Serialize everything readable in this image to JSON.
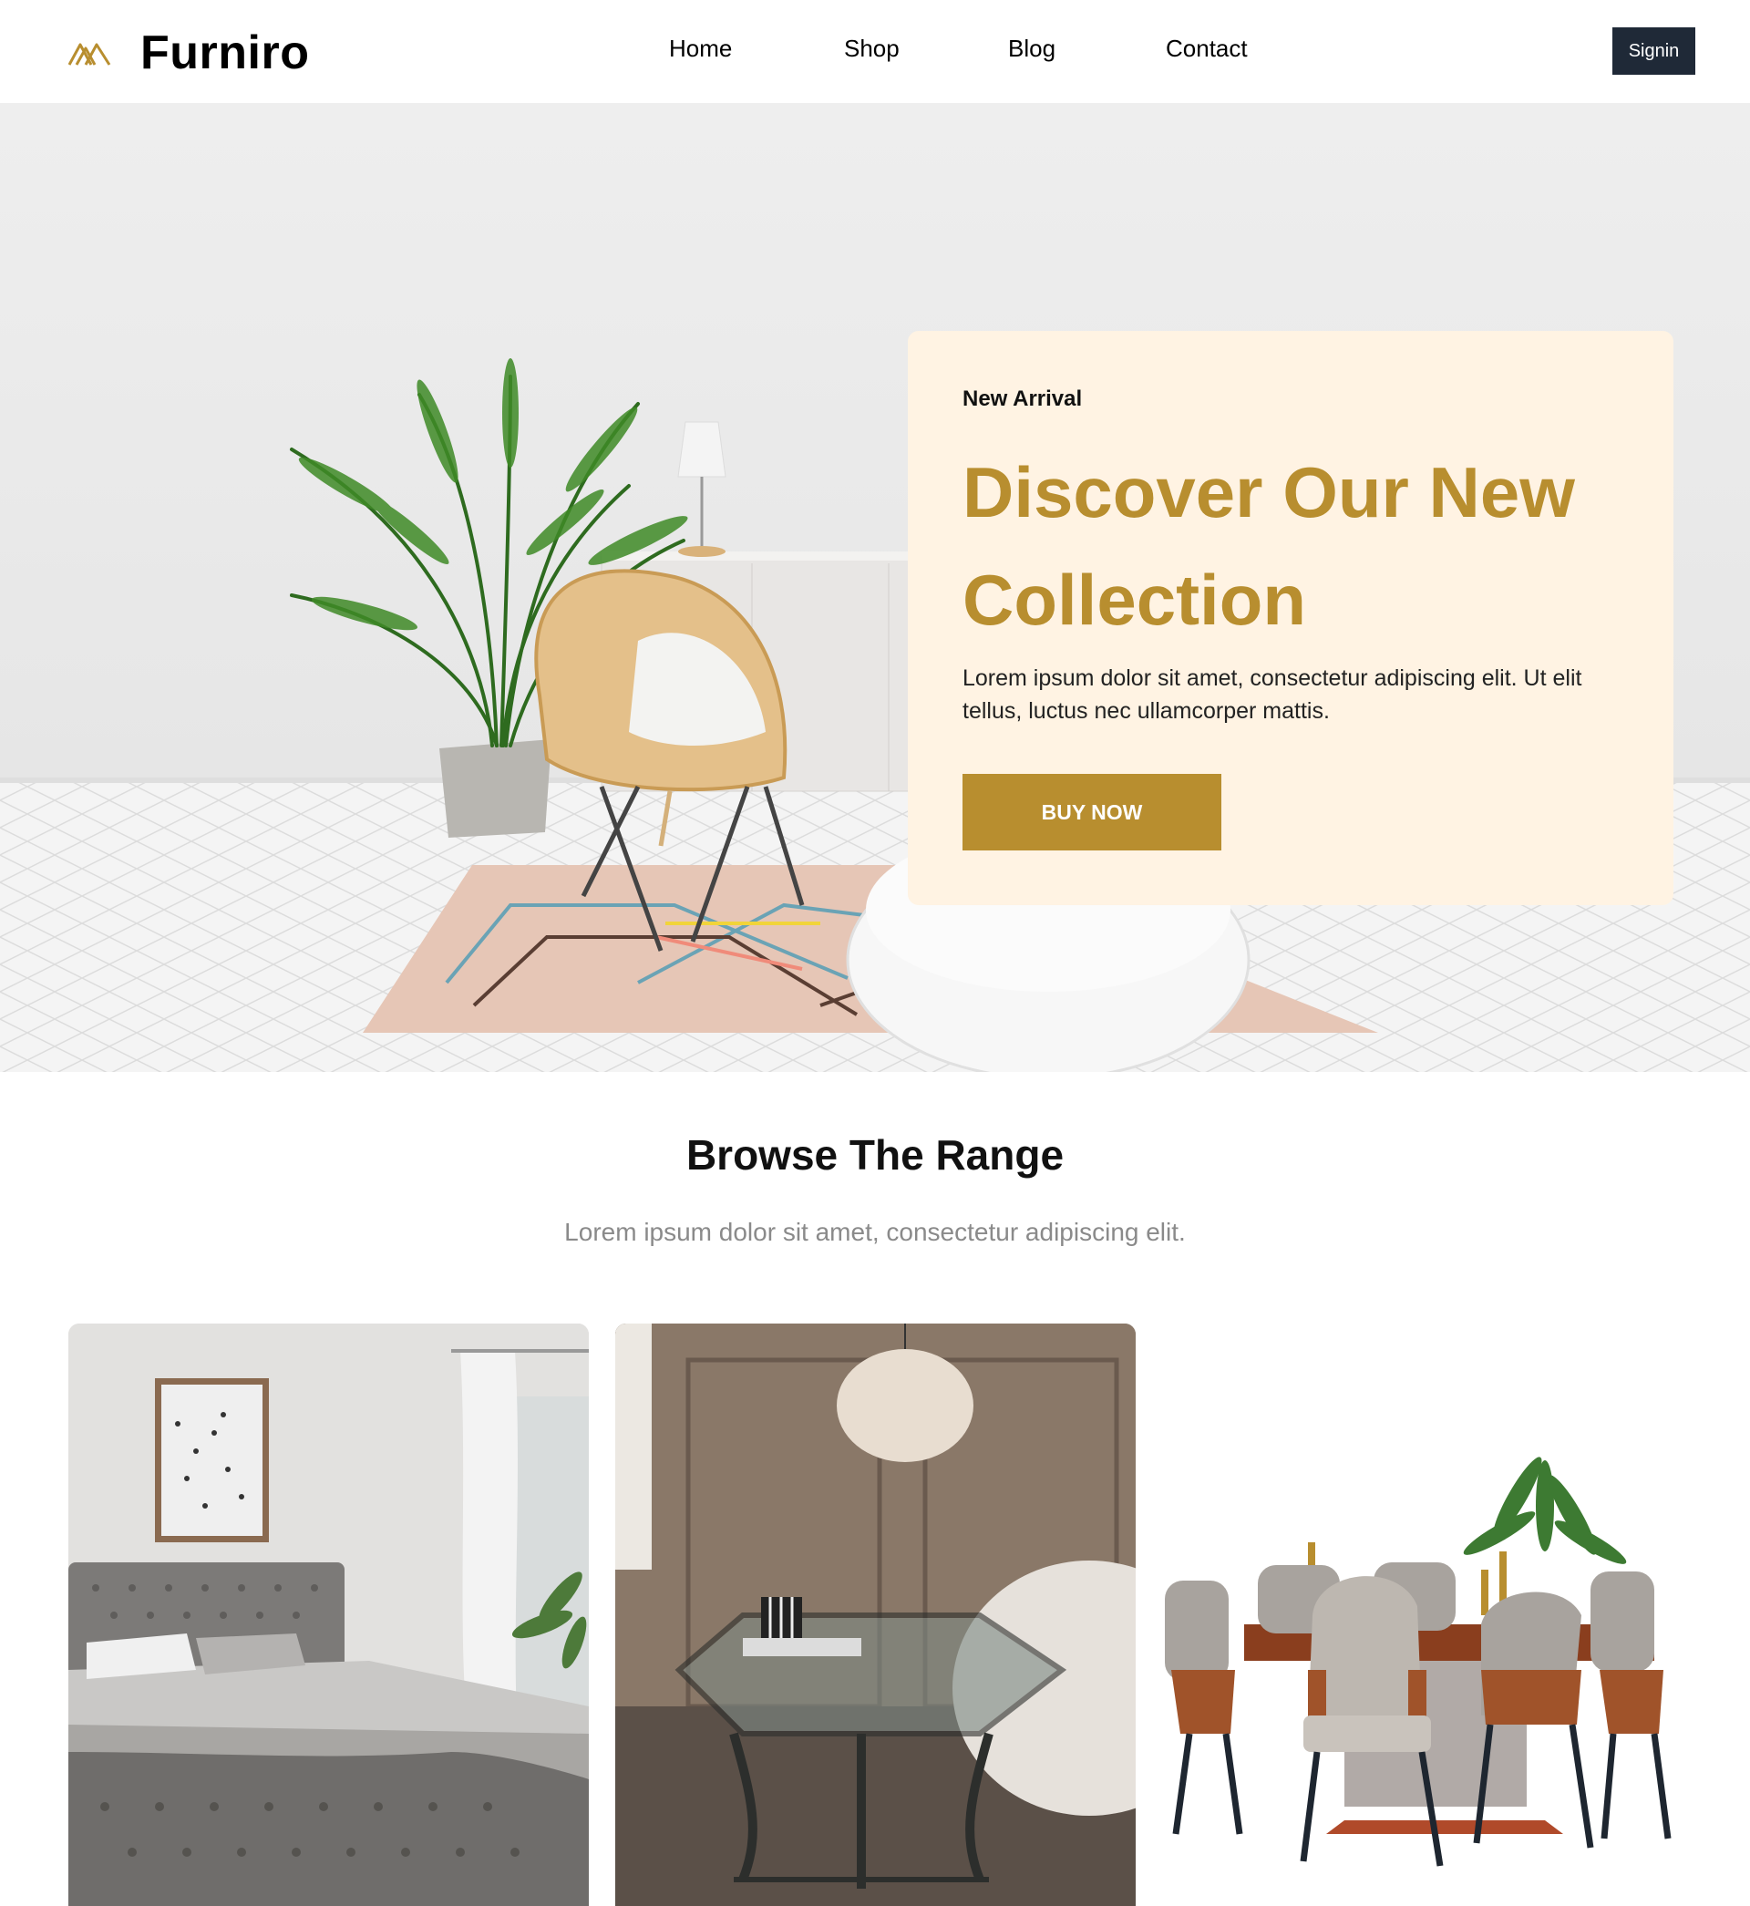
{
  "header": {
    "logo_text": "Furniro",
    "nav": [
      {
        "label": "Home"
      },
      {
        "label": "Shop"
      },
      {
        "label": "Blog"
      },
      {
        "label": "Contact"
      }
    ],
    "signin_label": "Signin"
  },
  "hero": {
    "eyebrow": "New Arrival",
    "title": "Discover Our New Collection",
    "description": "Lorem ipsum dolor sit amet, consectetur adipiscing elit. Ut elit tellus, luctus nec ullamcorper mattis.",
    "button_label": "BUY NOW",
    "image_icon": "living-room-scene"
  },
  "browse": {
    "title": "Browse The Range",
    "subtitle": "Lorem ipsum dolor sit amet, consectetur adipiscing elit.",
    "categories": [
      {
        "icon": "bedroom-image"
      },
      {
        "icon": "living-room-image"
      },
      {
        "icon": "dining-set-image"
      }
    ]
  },
  "colors": {
    "accent": "#b88e2f",
    "card_bg": "#fff3e3",
    "signin_bg": "#1f2937"
  }
}
